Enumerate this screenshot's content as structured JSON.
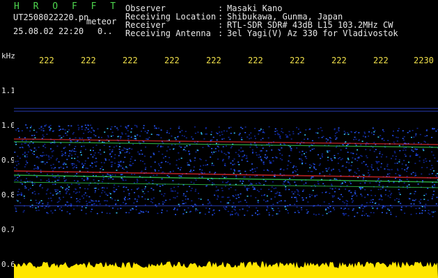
{
  "header": {
    "brand": "H R O F F T",
    "filename": "UT2508022220.pn",
    "meteor_tag": "meteor",
    "datetime": "25.08.02 22:20",
    "count": "0..",
    "fields": [
      {
        "label": "Observer",
        "sep": ":",
        "value": "Masaki Kano"
      },
      {
        "label": "Receiving Location",
        "sep": ":",
        "value": "Shibukawa, Gunma, Japan"
      },
      {
        "label": "Receiver",
        "sep": ":",
        "value": "RTL-SDR SDR# 43dB L15 103.2MHz CW"
      },
      {
        "label": "Receiving Antenna",
        "sep": ":",
        "value": "3el Yagi(V) Az 330 for Vladivostok"
      }
    ]
  },
  "axis": {
    "unit": "kHz",
    "time_ticks": [
      "222",
      "222",
      "222",
      "222",
      "222",
      "222",
      "222",
      "222",
      "222",
      "2230"
    ],
    "freq_ticks": [
      "1.1",
      "1.0",
      "0.9",
      "0.8",
      "0.7",
      "0.6"
    ]
  },
  "colors": {
    "header_green": "#4ed54e",
    "tick_yellow": "#f0e04a",
    "noise_band": "#1a3cff",
    "signal_red": "#ff3030",
    "signal_green": "#40ff60",
    "amplitude": "#ffe600"
  }
}
